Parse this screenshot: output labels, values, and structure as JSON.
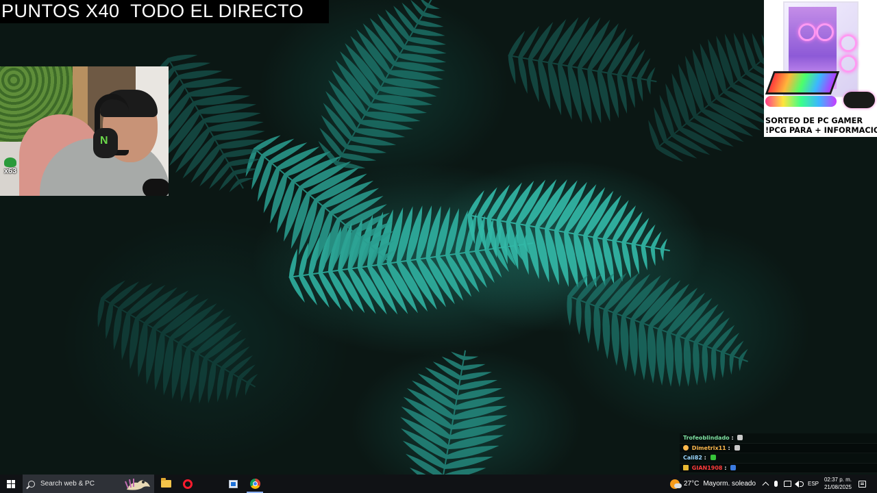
{
  "overlay": {
    "title": "PUNTOS X40  TODO EL DIRECTO",
    "webcam_badge": "x63"
  },
  "giveaway": {
    "line1": "SORTEO DE PC GAMER",
    "line2": "!PCG PARA + INFORMACION"
  },
  "chat": {
    "messages": [
      {
        "user": "Trofeoblindado",
        "color": "#7ee0a0",
        "emote": "sword-icon"
      },
      {
        "user": "Dimetrix11",
        "color": "#ffb84d",
        "emote": "sword-icon"
      },
      {
        "user": "Cali82",
        "color": "#9ad6ff",
        "emote": "green-emote-icon"
      },
      {
        "user": "GIAN1908",
        "color": "#ff3b3b",
        "emote": "car-emote-icon"
      }
    ]
  },
  "taskbar": {
    "search_placeholder": "Search web & PC",
    "apps": [
      "file-explorer-icon",
      "opera-icon",
      "store-icon",
      "chrome-icon"
    ],
    "weather": {
      "temp": "27°C",
      "condition": "Mayorm. soleado"
    },
    "language": "ESP",
    "time": "02:37 p. m.",
    "date": "21/08/2025"
  },
  "colors": {
    "taskbar_bg": "#101215",
    "search_bg": "#2e3137",
    "wallpaper_teal": "#2ea99a"
  }
}
